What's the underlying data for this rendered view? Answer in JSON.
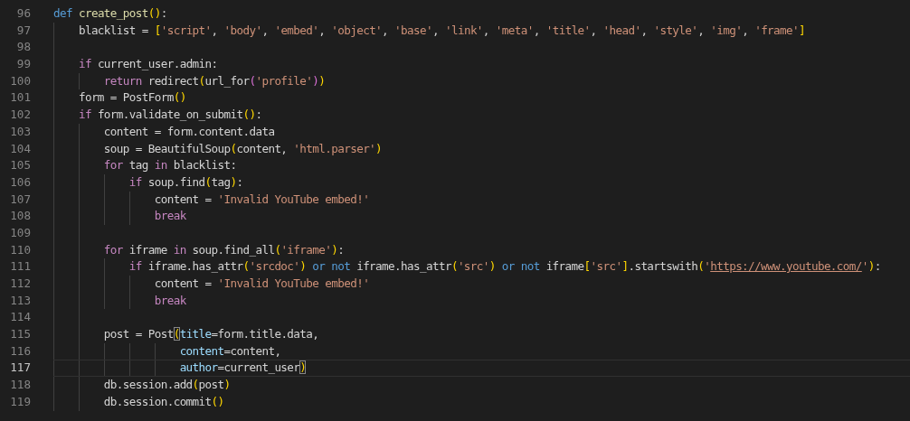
{
  "editor": {
    "lines": [
      {
        "number": "96",
        "current": false,
        "tokens": [
          {
            "t": "def",
            "kind": "kw"
          },
          {
            "t": " create_post",
            "kind": "fn"
          },
          {
            "t": "(",
            "kind": "b1"
          },
          {
            "t": ")",
            "kind": "b1"
          },
          {
            "t": ":",
            "kind": "p"
          }
        ]
      },
      {
        "number": "97",
        "current": false,
        "tokens": [
          {
            "t": "    blacklist = ",
            "kind": "p"
          },
          {
            "t": "[",
            "kind": "b1"
          },
          {
            "t": "'script'",
            "kind": "str"
          },
          {
            "t": ", ",
            "kind": "p"
          },
          {
            "t": "'body'",
            "kind": "str"
          },
          {
            "t": ", ",
            "kind": "p"
          },
          {
            "t": "'embed'",
            "kind": "str"
          },
          {
            "t": ", ",
            "kind": "p"
          },
          {
            "t": "'object'",
            "kind": "str"
          },
          {
            "t": ", ",
            "kind": "p"
          },
          {
            "t": "'base'",
            "kind": "str"
          },
          {
            "t": ", ",
            "kind": "p"
          },
          {
            "t": "'link'",
            "kind": "str"
          },
          {
            "t": ", ",
            "kind": "p"
          },
          {
            "t": "'meta'",
            "kind": "str"
          },
          {
            "t": ", ",
            "kind": "p"
          },
          {
            "t": "'title'",
            "kind": "str"
          },
          {
            "t": ", ",
            "kind": "p"
          },
          {
            "t": "'head'",
            "kind": "str"
          },
          {
            "t": ", ",
            "kind": "p"
          },
          {
            "t": "'style'",
            "kind": "str"
          },
          {
            "t": ", ",
            "kind": "p"
          },
          {
            "t": "'img'",
            "kind": "str"
          },
          {
            "t": ", ",
            "kind": "p"
          },
          {
            "t": "'frame'",
            "kind": "str"
          },
          {
            "t": "]",
            "kind": "b1"
          }
        ]
      },
      {
        "number": "98",
        "current": false
      },
      {
        "number": "99",
        "current": false,
        "tokens": [
          {
            "t": "    if",
            "kind": "ctl"
          },
          {
            "t": " current_user.admin:",
            "kind": "p"
          }
        ]
      },
      {
        "number": "100",
        "current": false,
        "tokens": [
          {
            "t": "        return",
            "kind": "ctl"
          },
          {
            "t": " redirect",
            "kind": "p"
          },
          {
            "t": "(",
            "kind": "b1"
          },
          {
            "t": "url_for",
            "kind": "p"
          },
          {
            "t": "(",
            "kind": "b2"
          },
          {
            "t": "'profile'",
            "kind": "str"
          },
          {
            "t": ")",
            "kind": "b2"
          },
          {
            "t": ")",
            "kind": "b1"
          }
        ]
      },
      {
        "number": "101",
        "current": false,
        "tokens": [
          {
            "t": "    form = PostForm",
            "kind": "p"
          },
          {
            "t": "(",
            "kind": "b1"
          },
          {
            "t": ")",
            "kind": "b1"
          }
        ]
      },
      {
        "number": "102",
        "current": false,
        "tokens": [
          {
            "t": "    if",
            "kind": "ctl"
          },
          {
            "t": " form.validate_on_submit",
            "kind": "p"
          },
          {
            "t": "(",
            "kind": "b1"
          },
          {
            "t": ")",
            "kind": "b1"
          },
          {
            "t": ":",
            "kind": "p"
          }
        ]
      },
      {
        "number": "103",
        "current": false,
        "tokens": [
          {
            "t": "        content = form.content.data",
            "kind": "p"
          }
        ]
      },
      {
        "number": "104",
        "current": false,
        "tokens": [
          {
            "t": "        soup = BeautifulSoup",
            "kind": "p"
          },
          {
            "t": "(",
            "kind": "b1"
          },
          {
            "t": "content, ",
            "kind": "p"
          },
          {
            "t": "'html.parser'",
            "kind": "str"
          },
          {
            "t": ")",
            "kind": "b1"
          }
        ]
      },
      {
        "number": "105",
        "current": false,
        "tokens": [
          {
            "t": "        for",
            "kind": "ctl"
          },
          {
            "t": " tag ",
            "kind": "p"
          },
          {
            "t": "in",
            "kind": "ctl"
          },
          {
            "t": " blacklist:",
            "kind": "p"
          }
        ]
      },
      {
        "number": "106",
        "current": false,
        "tokens": [
          {
            "t": "            if",
            "kind": "ctl"
          },
          {
            "t": " soup.find",
            "kind": "p"
          },
          {
            "t": "(",
            "kind": "b1"
          },
          {
            "t": "tag",
            "kind": "p"
          },
          {
            "t": ")",
            "kind": "b1"
          },
          {
            "t": ":",
            "kind": "p"
          }
        ]
      },
      {
        "number": "107",
        "current": false,
        "tokens": [
          {
            "t": "                content = ",
            "kind": "p"
          },
          {
            "t": "'Invalid YouTube embed!'",
            "kind": "str"
          }
        ]
      },
      {
        "number": "108",
        "current": false,
        "tokens": [
          {
            "t": "                break",
            "kind": "ctl"
          }
        ]
      },
      {
        "number": "109",
        "current": false
      },
      {
        "number": "110",
        "current": false,
        "tokens": [
          {
            "t": "        for",
            "kind": "ctl"
          },
          {
            "t": " iframe ",
            "kind": "p"
          },
          {
            "t": "in",
            "kind": "ctl"
          },
          {
            "t": " soup.find_all",
            "kind": "p"
          },
          {
            "t": "(",
            "kind": "b1"
          },
          {
            "t": "'iframe'",
            "kind": "str"
          },
          {
            "t": ")",
            "kind": "b1"
          },
          {
            "t": ":",
            "kind": "p"
          }
        ]
      },
      {
        "number": "111",
        "current": false,
        "tokens": [
          {
            "t": "            if",
            "kind": "ctl"
          },
          {
            "t": " iframe.has_attr",
            "kind": "p"
          },
          {
            "t": "(",
            "kind": "b1"
          },
          {
            "t": "'srcdoc'",
            "kind": "str"
          },
          {
            "t": ")",
            "kind": "b1"
          },
          {
            "t": " or not",
            "kind": "kw"
          },
          {
            "t": " iframe.has_attr",
            "kind": "p"
          },
          {
            "t": "(",
            "kind": "b1"
          },
          {
            "t": "'src'",
            "kind": "str"
          },
          {
            "t": ")",
            "kind": "b1"
          },
          {
            "t": " or not",
            "kind": "kw"
          },
          {
            "t": " iframe",
            "kind": "p"
          },
          {
            "t": "[",
            "kind": "b1"
          },
          {
            "t": "'src'",
            "kind": "str"
          },
          {
            "t": "]",
            "kind": "b1"
          },
          {
            "t": ".startswith",
            "kind": "p"
          },
          {
            "t": "(",
            "kind": "b1"
          },
          {
            "t": "'",
            "kind": "str"
          },
          {
            "t": "https://www.youtube.com/",
            "kind": "url"
          },
          {
            "t": "'",
            "kind": "str"
          },
          {
            "t": ")",
            "kind": "b1"
          },
          {
            "t": ":",
            "kind": "p"
          }
        ]
      },
      {
        "number": "112",
        "current": false,
        "tokens": [
          {
            "t": "                content = ",
            "kind": "p"
          },
          {
            "t": "'Invalid YouTube embed!'",
            "kind": "str"
          }
        ]
      },
      {
        "number": "113",
        "current": false,
        "tokens": [
          {
            "t": "                break",
            "kind": "ctl"
          }
        ]
      },
      {
        "number": "114",
        "current": false
      },
      {
        "number": "115",
        "current": false,
        "tokens": [
          {
            "t": "        post = Post",
            "kind": "p"
          },
          {
            "t": "(",
            "kind": "b1match"
          },
          {
            "t": "title",
            "kind": "param"
          },
          {
            "t": "=form.title.data,",
            "kind": "p"
          }
        ]
      },
      {
        "number": "116",
        "current": false,
        "tokens": [
          {
            "t": "                    content",
            "kind": "param"
          },
          {
            "t": "=content,",
            "kind": "p"
          }
        ]
      },
      {
        "number": "117",
        "current": true,
        "tokens": [
          {
            "t": "                    author",
            "kind": "param"
          },
          {
            "t": "=current_user",
            "kind": "p"
          },
          {
            "t": ")",
            "kind": "b1match"
          }
        ]
      },
      {
        "number": "118",
        "current": false,
        "tokens": [
          {
            "t": "        db.session.add",
            "kind": "p"
          },
          {
            "t": "(",
            "kind": "b1"
          },
          {
            "t": "post",
            "kind": "p"
          },
          {
            "t": ")",
            "kind": "b1"
          }
        ]
      },
      {
        "number": "119",
        "current": false,
        "tokens": [
          {
            "t": "        db.session.commit",
            "kind": "p"
          },
          {
            "t": "(",
            "kind": "b1"
          },
          {
            "t": ")",
            "kind": "b1"
          }
        ]
      }
    ]
  }
}
